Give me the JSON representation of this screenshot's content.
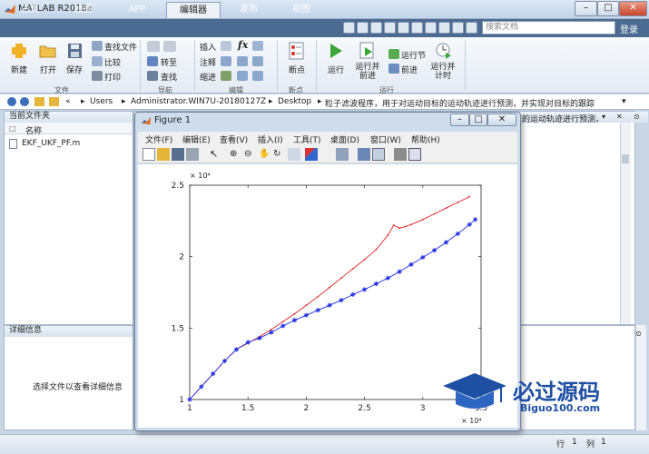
{
  "app": {
    "title": "MATLAB R2018a"
  },
  "window_controls": {
    "minimize": "–",
    "maximize": "□",
    "close": "✕"
  },
  "tabs": [
    {
      "label": "主页"
    },
    {
      "label": "绘图"
    },
    {
      "label": "APP"
    },
    {
      "label": "编辑器"
    },
    {
      "label": "发布"
    },
    {
      "label": "视图"
    }
  ],
  "search": {
    "placeholder": "搜索文档"
  },
  "login_label": "登录",
  "ribbon": {
    "file": {
      "new": "新建",
      "open": "打开",
      "save": "保存",
      "find_files": "查找文件",
      "compare": "比较",
      "print": "打印",
      "group": "文件"
    },
    "navigate": {
      "goto": "转至",
      "find": "查找",
      "group": "导航"
    },
    "edit": {
      "insert": "插入",
      "comment": "注释",
      "indent": "缩进",
      "fx": "fx",
      "group": "编辑"
    },
    "breakpoints": {
      "breakpoints": "断点",
      "group": "断点"
    },
    "run": {
      "run": "运行",
      "run_advance": "运行并\n前进",
      "run_section": "运行节",
      "advance": "前进",
      "run_time": "运行并\n计时",
      "group": "运行"
    }
  },
  "address": {
    "crumbs": [
      "«",
      "Users",
      "Administrator.WIN7U-20180127Z",
      "Desktop",
      "粒子滤波程序，用于对运动目标的运动轨迹进行预测，并实现对目标的跟踪"
    ]
  },
  "current_folder": {
    "title": "当前文件夹",
    "name_header": "名称",
    "files": [
      "EKF_UKF_PF.m"
    ]
  },
  "details": {
    "title": "详细信息",
    "hint": "选择文件以查看详细信息"
  },
  "editor_tab_text": "的运动轨迹进行预测，",
  "status": {
    "row_label": "行",
    "row": "1",
    "col_label": "列",
    "col": "1"
  },
  "figure": {
    "title": "Figure 1",
    "menu": [
      "文件(F)",
      "编辑(E)",
      "查看(V)",
      "插入(I)",
      "工具(T)",
      "桌面(D)",
      "窗口(W)",
      "帮助(H)"
    ]
  },
  "chart_data": {
    "type": "line",
    "x_tick_labels": [
      "1",
      "1.5",
      "2",
      "2.5",
      "3",
      "3.5"
    ],
    "y_tick_labels": [
      "1",
      "1.5",
      "2",
      "2.5"
    ],
    "x_exponent": "× 10⁴",
    "y_exponent": "× 10⁴",
    "xlim": [
      10000,
      35000
    ],
    "ylim": [
      10000,
      25000
    ],
    "series": [
      {
        "marker": "dot",
        "color": "#e02020",
        "x": [
          10000,
          11000,
          12000,
          13000,
          14000,
          15000,
          16000,
          17000,
          18000,
          19000,
          20000,
          21000,
          22000,
          23000,
          24000,
          25000,
          26000,
          27000,
          27500,
          28000,
          28500,
          29000,
          30000,
          31000,
          32000,
          33000,
          34000
        ],
        "y": [
          10000,
          10900,
          11800,
          12700,
          13500,
          13950,
          14400,
          14900,
          15450,
          16000,
          16600,
          17200,
          17850,
          18500,
          19150,
          19800,
          20500,
          21500,
          22200,
          22000,
          22100,
          22250,
          22600,
          23000,
          23400,
          23800,
          24200
        ]
      },
      {
        "marker": "star",
        "color": "#1f2fe0",
        "x": [
          10000,
          11000,
          12000,
          13000,
          14000,
          15000,
          16000,
          17000,
          18000,
          19000,
          20000,
          21000,
          22000,
          23000,
          24000,
          25000,
          26000,
          27000,
          28000,
          29000,
          30000,
          31000,
          32000,
          33000,
          34000,
          34500
        ],
        "y": [
          10000,
          10900,
          11800,
          12700,
          13500,
          14000,
          14300,
          14700,
          15150,
          15550,
          15900,
          16250,
          16600,
          16950,
          17350,
          17700,
          18100,
          18500,
          18950,
          19450,
          19950,
          20450,
          21000,
          21600,
          22250,
          22600
        ]
      }
    ]
  },
  "watermark": {
    "text": "必过源码",
    "sub": "Biguo100.com"
  }
}
